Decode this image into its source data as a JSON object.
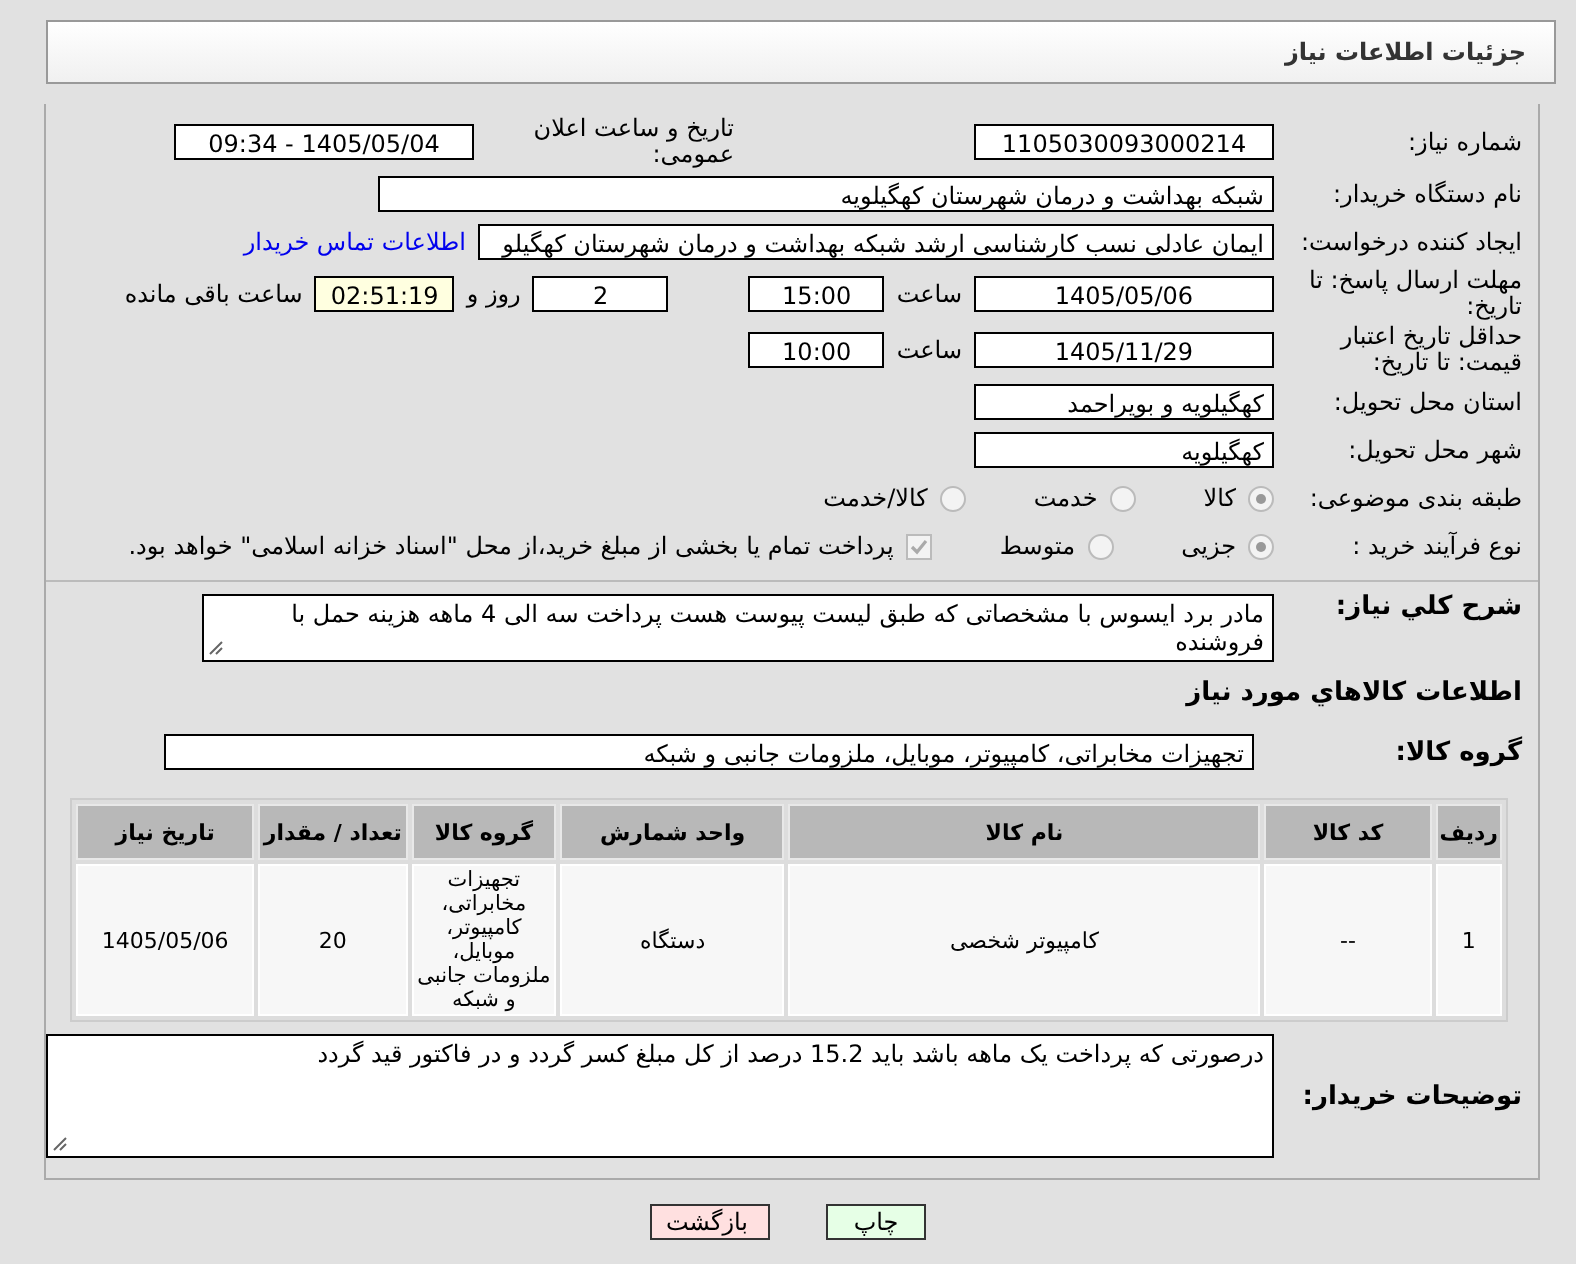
{
  "header": {
    "title": "جزئیات اطلاعات نیاز"
  },
  "need_number": {
    "label": "شماره نیاز:",
    "value": "1105030093000214"
  },
  "announce": {
    "label": "تاریخ و ساعت اعلان عمومی:",
    "value": "1405/05/04 - 09:34"
  },
  "buyer_org": {
    "label": "نام دستگاه خریدار:",
    "value": "شبکه بهداشت و درمان شهرستان کهگیلویه"
  },
  "requester": {
    "label": "ایجاد کننده درخواست:",
    "value": "ایمان عادلی نسب کارشناسی ارشد شبکه بهداشت و درمان شهرستان کهگیلو",
    "link": "اطلاعات تماس خریدار"
  },
  "deadline": {
    "label": "مهلت ارسال پاسخ: تا تاریخ:",
    "date": "1405/05/06",
    "time_label": "ساعت",
    "time": "15:00",
    "days": "2",
    "days_label": "روز و",
    "remaining": "02:51:19",
    "remaining_label": "ساعت باقی مانده"
  },
  "validity": {
    "label": "حداقل تاریخ اعتبار قیمت: تا تاریخ:",
    "date": "1405/11/29",
    "time_label": "ساعت",
    "time": "10:00"
  },
  "province": {
    "label": "استان محل تحویل:",
    "value": "کهگیلویه و بویراحمد"
  },
  "city": {
    "label": "شهر محل تحویل:",
    "value": "کهگیلویه"
  },
  "category": {
    "label": "طبقه بندی موضوعی:",
    "options": [
      {
        "label": "کالا",
        "selected": true
      },
      {
        "label": "خدمت",
        "selected": false
      },
      {
        "label": "کالا/خدمت",
        "selected": false
      }
    ]
  },
  "process": {
    "label": "نوع فرآیند خرید :",
    "options": [
      {
        "label": "جزیی",
        "selected": true
      },
      {
        "label": "متوسط",
        "selected": false
      }
    ],
    "payment": {
      "checked": true,
      "label": "پرداخت تمام یا بخشی از مبلغ خرید،از محل \"اسناد خزانه اسلامی\" خواهد بود."
    }
  },
  "description": {
    "label": "شرح کلي نياز:",
    "value": "مادر برد ایسوس  با مشخصاتی که طبق لیست پیوست هست پرداخت سه الی 4 ماهه هزینه حمل با فروشنده"
  },
  "goods_title": "اطلاعات کالاهاي مورد نياز",
  "goods_group": {
    "label": "گروه کالا:",
    "value": "تجهیزات مخابراتی، کامپیوتر، موبایل، ملزومات جانبی و شبکه"
  },
  "table": {
    "columns": [
      "ردیف",
      "کد کالا",
      "نام کالا",
      "واحد شمارش",
      "گروه کالا",
      "تعداد / مقدار",
      "تاریخ نیاز"
    ],
    "rows": [
      [
        "1",
        "--",
        "کامپیوتر شخصی",
        "دستگاه",
        "تجهیزات مخابراتی، کامپیوتر، موبایل، ملزومات جانبی و شبکه",
        "20",
        "1405/05/06"
      ]
    ]
  },
  "buyer_notes": {
    "label": "توضیحات خریدار:",
    "value": "درصورتی که پرداخت یک ماهه باشد باید 15.2 درصد از کل مبلغ کسر گردد و در فاکتور قید گردد"
  },
  "buttons": [
    {
      "label": "چاپ",
      "kind": "print"
    },
    {
      "label": "بازگشت",
      "kind": "back"
    }
  ]
}
